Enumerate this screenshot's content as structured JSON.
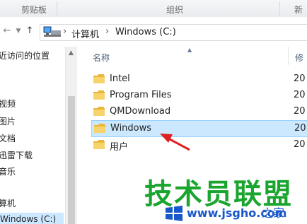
{
  "ribbon": {
    "groups": [
      "剪贴板",
      "组织",
      "新"
    ]
  },
  "nav": {
    "back_icon": "back-arrow-icon",
    "forward_icon": "forward-arrow-icon",
    "dropdown_icon": "chevron-down-icon",
    "up_icon": "up-arrow-icon",
    "breadcrumb": [
      "计算机",
      "Windows (C:)"
    ],
    "separator": "›"
  },
  "navpane": {
    "items": [
      "近访问的位置",
      "视频",
      "图片",
      "文档",
      "迅雷下载",
      "音乐",
      "算机",
      "Windows (C:)"
    ],
    "selected_index": 7
  },
  "filelist": {
    "columns": {
      "name": "名称",
      "modified": "修"
    },
    "rows": [
      {
        "name": "Intel",
        "date": "20"
      },
      {
        "name": "Program Files",
        "date": "20"
      },
      {
        "name": "QMDownload",
        "date": "20"
      },
      {
        "name": "Windows",
        "date": "20"
      },
      {
        "name": "用户",
        "date": "20"
      }
    ],
    "selected_index": 3
  },
  "watermark": {
    "text": "技术员联盟",
    "url": "www.jsgho.com",
    "suffix": "之家",
    "color_main": "#1aa52f",
    "color_url": "#1a58c9"
  },
  "colors": {
    "selection_bg": "#cce8ff",
    "selection_border": "#99d1ff",
    "folder_yellow": "#f2c94c",
    "annotation_red": "#e02020"
  }
}
